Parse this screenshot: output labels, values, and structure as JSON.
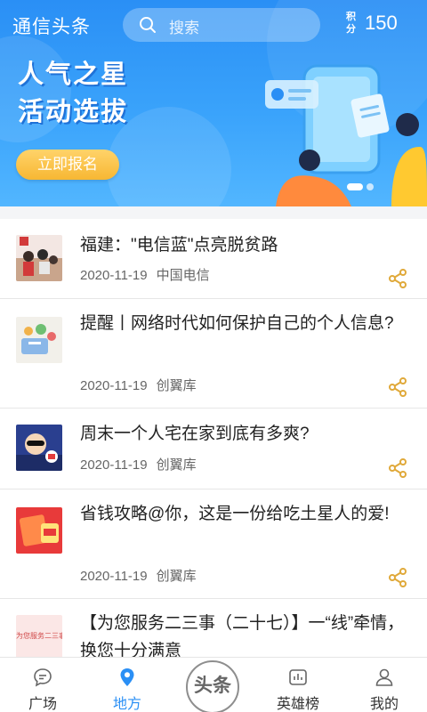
{
  "header": {
    "app_title": "通信头条",
    "search_placeholder": "搜索",
    "points_label": "积分",
    "points_value": "150"
  },
  "banner": {
    "title_line1": "人气之星",
    "title_line2": "活动选拔",
    "signup_label": "立即报名"
  },
  "news": [
    {
      "title": "福建：\"电信蓝\"点亮脱贫路",
      "date": "2020-11-19",
      "source": "中国电信"
    },
    {
      "title": "提醒丨网络时代如何保护自己的个人信息?",
      "date": "2020-11-19",
      "source": "创翼库"
    },
    {
      "title": "周末一个人宅在家到底有多爽?",
      "date": "2020-11-19",
      "source": "创翼库"
    },
    {
      "title": "省钱攻略@你，这是一份给吃土星人的爱!",
      "date": "2020-11-19",
      "source": "创翼库"
    },
    {
      "title": "【为您服务二三事（二十七）】一“线”牵情，换您十分满意",
      "date": "",
      "source": ""
    }
  ],
  "thumbs": {
    "item5_text": "为您服务二三事"
  },
  "nav": {
    "items": [
      {
        "label": "广场",
        "icon": "chat-bubble-icon"
      },
      {
        "label": "地方",
        "icon": "location-pin-icon"
      },
      {
        "label": "头条",
        "icon": "headline-circle-icon"
      },
      {
        "label": "英雄榜",
        "icon": "leaderboard-icon"
      },
      {
        "label": "我的",
        "icon": "user-icon"
      }
    ],
    "active": "地方"
  },
  "colors": {
    "brand_blue": "#2a8ff5",
    "button_yellow": "#f7b733",
    "share_icon": "#e0a93a"
  }
}
